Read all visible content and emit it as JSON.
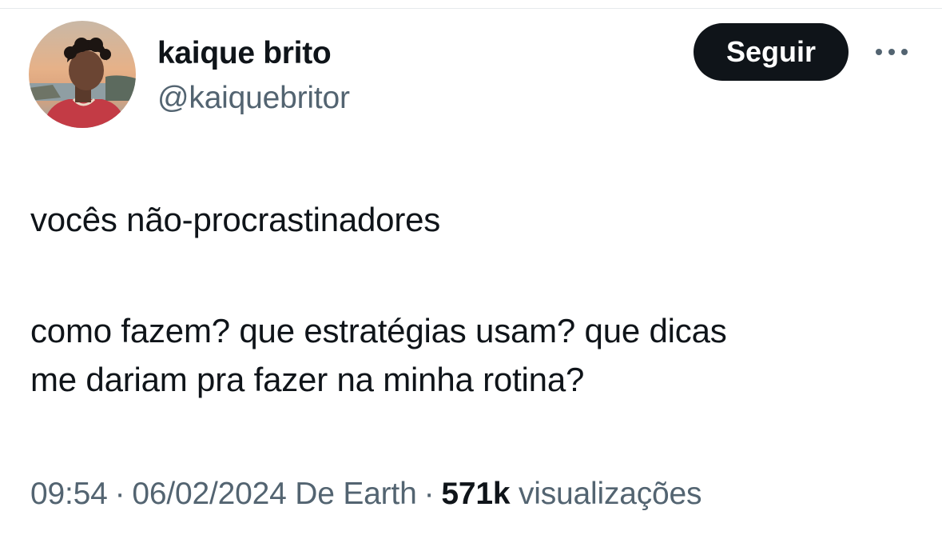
{
  "author": {
    "display_name": "kaique brito",
    "handle": "@kaiquebritor",
    "avatar_icon": "profile-photo"
  },
  "actions": {
    "follow_label": "Seguir",
    "more_icon": "ellipsis-icon"
  },
  "tweet": {
    "paragraphs": [
      [
        "vocês não-procrastinadores"
      ],
      [
        "como fazem? que estratégias usam? que dicas",
        "me dariam pra fazer na minha rotina?"
      ]
    ]
  },
  "meta": {
    "time": "09:54",
    "separator": "·",
    "date": "06/02/2024",
    "source": "De Earth",
    "views_count": "571k",
    "views_label": "visualizações"
  },
  "colors": {
    "text_primary": "#0f1419",
    "text_secondary": "#536471",
    "button_bg": "#0f1419",
    "button_text": "#ffffff"
  }
}
